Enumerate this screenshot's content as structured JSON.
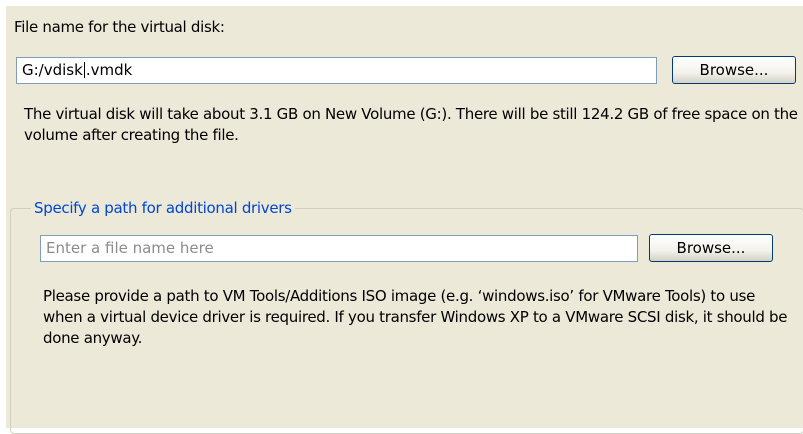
{
  "virtual_disk": {
    "label": "File name for the virtual disk:",
    "file_path_before_caret": "G:/vdisk",
    "file_path_after_caret": ".vmdk",
    "browse_label": "Browse...",
    "info_text": "The virtual disk will take about 3.1 GB on New Volume (G:). There will be still 124.2 GB of free space on the volume after creating the file."
  },
  "drivers": {
    "group_title": "Specify a path for additional drivers",
    "placeholder": "Enter a file name here",
    "browse_label": "Browse...",
    "info_text": "Please provide a path to VM Tools/Additions ISO image (e.g. ‘windows.iso’ for VMware Tools) to use when a virtual device driver is required. If you transfer Windows XP to a VMware SCSI disk, it should be done anyway."
  }
}
